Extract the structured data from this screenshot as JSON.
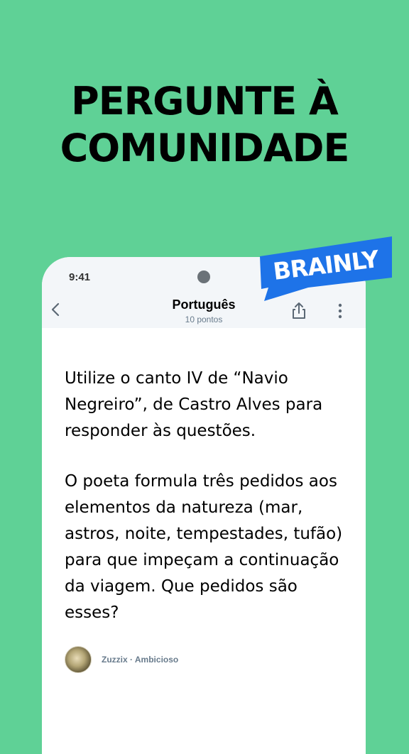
{
  "promo": {
    "headline_line1": "PERGUNTE À",
    "headline_line2": "COMUNIDADE"
  },
  "brand": {
    "logo_text": "BRAINLY",
    "color": "#1e73e8"
  },
  "status_bar": {
    "time": "9:41"
  },
  "nav": {
    "back_icon": "chevron-left-icon",
    "title": "Português",
    "subtitle": "10 pontos",
    "share_icon": "share-icon",
    "more_icon": "more-vertical-icon"
  },
  "question": {
    "paragraph1": "Utilize o canto IV de “Navio Negreiro”, de Castro Alves para responder às questões.",
    "paragraph2": "O poeta formula três pedidos aos elementos da natureza (mar, astros, noite, tempestades, tufão) para que impeçam a continuação da viagem. Que pedidos são esses?"
  },
  "author": {
    "name": "Zuzzix",
    "separator": " · ",
    "rank": "Ambicioso"
  },
  "colors": {
    "background": "#5fd196",
    "header_bg": "#f3f6f9",
    "muted_text": "#687b8c"
  }
}
